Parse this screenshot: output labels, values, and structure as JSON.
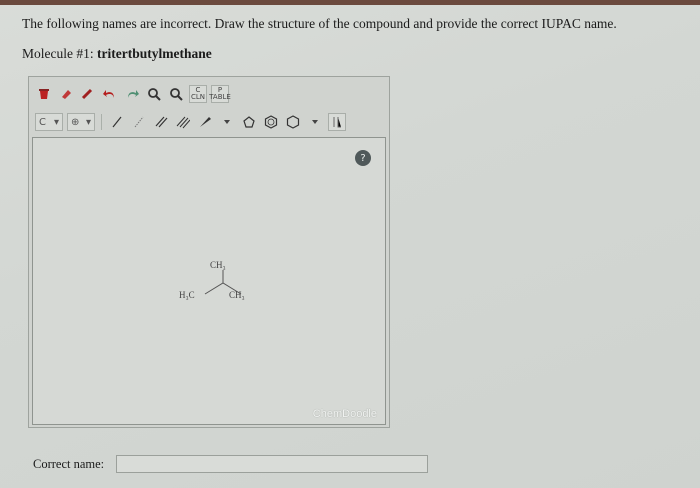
{
  "question": {
    "instruction": "The following names are incorrect. Draw the structure of the compound and provide the correct IUPAC name.",
    "molecule_label": "Molecule #1:",
    "molecule_name": "tritertbutylmethane"
  },
  "editor": {
    "toolbar_row1_icons": [
      "clear-icon",
      "erase-icon",
      "lasso-icon",
      "undo-icon",
      "redo-icon",
      "zoom-in-icon",
      "zoom-out-icon",
      "clean-icon",
      "periodic-icon"
    ],
    "clean_label_top": "C",
    "clean_label_bottom": "CLN",
    "periodic_label_top": "P",
    "periodic_label_bottom": "TABLE",
    "element_dropdown": "C",
    "charge_dropdown": "⊕",
    "help_label": "?",
    "brand": "ChemDoodle",
    "molecule_atoms": {
      "top": "CH₃",
      "left": "H₃C",
      "right": "CH₃"
    }
  },
  "answer": {
    "label": "Correct name:",
    "value": "",
    "placeholder": ""
  },
  "colors": {
    "background": "#d5d8d4",
    "top_strip": "#6b4a3e",
    "help_button": "#50595a"
  }
}
